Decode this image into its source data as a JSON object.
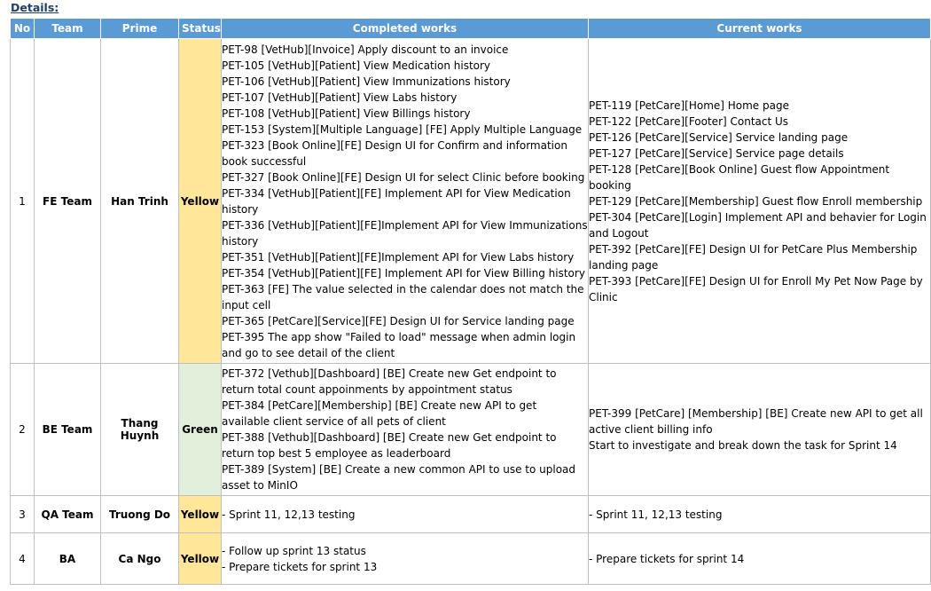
{
  "section_title": "Details:",
  "columns": [
    "No",
    "Team",
    "Prime",
    "Status",
    "Completed works",
    "Current works"
  ],
  "rows": [
    {
      "no": "1",
      "team": "FE Team",
      "prime": "Han Trinh",
      "status": "Yellow",
      "status_color": "#ffe699",
      "completed": "PET-98 [VetHub][Invoice] Apply discount to an invoice\nPET-105 [VetHub][Patient] View Medication history\nPET-106 [VetHub][Patient] View Immunizations history\nPET-107 [VetHub][Patient] View Labs history\nPET-108 [VetHub][Patient] View Billings history\nPET-153 [System][Multiple Language] [FE] Apply Multiple Language\nPET-323 [Book Online][FE] Design UI for Confirm and information book successful\nPET-327 [Book Online][FE] Design UI for select Clinic before booking\nPET-334 [VetHub][Patient][FE] Implement API for View Medication history\nPET-336 [VetHub][Patient][FE]Implement API for View Immunizations history\nPET-351 [VetHub][Patient][FE]Implement API for View Labs history\nPET-354 [VetHub][Patient][FE] Implement API for View Billing history\nPET-363 [FE] The value selected in the calendar does not match the input cell\nPET-365 [PetCare][Service][FE] Design UI for Service landing page\nPET-395 The app show \"Failed to load\" message when admin login and go to see detail of the client",
      "current": "PET-119 [PetCare][Home] Home page\nPET-122 [PetCare][Footer] Contact Us\nPET-126 [PetCare][Service] Service landing page\nPET-127 [PetCare][Service] Service page details\nPET-128 [PetCare][Book Online] Guest flow Appointment booking\nPET-129 [PetCare][Membership] Guest flow Enroll membership\nPET-304 [PetCare][Login] Implement API and behavier for Login and Logout\nPET-392 [PetCare][FE] Design UI for PetCare Plus Membership landing page\nPET-393 [PetCare][FE] Design UI for Enroll My Pet Now Page by Clinic"
    },
    {
      "no": "2",
      "team": "BE Team",
      "prime": "Thang Huynh",
      "status": "Green",
      "status_color": "#e2efda",
      "completed": "PET-372 [Vethub][Dashboard] [BE] Create new Get endpoint to return total count appoinments by appointment status\nPET-384 [PetCare][Membership] [BE] Create new API to get available client service of all pets of client\nPET-388 [Vethub][Dashboard] [BE] Create new Get endpoint to return top best 5 employee as leaderboard\nPET-389 [System] [BE] Create a new common API to use to upload asset to MinIO",
      "current": "PET-399 [PetCare] [Membership] [BE] Create new API to get all active client billing info\nStart to investigate and break down the task for Sprint 14"
    },
    {
      "no": "3",
      "team": "QA Team",
      "prime": "Truong Do",
      "status": "Yellow",
      "status_color": "#ffe699",
      "completed": "- Sprint 11, 12,13 testing",
      "current": "- Sprint 11, 12,13 testing"
    },
    {
      "no": "4",
      "team": "BA",
      "prime": "Ca Ngo",
      "status": "Yellow",
      "status_color": "#ffe699",
      "completed": "- Follow up sprint 13 status\n- Prepare tickets for sprint 13",
      "current": "- Prepare tickets for sprint 14"
    }
  ]
}
